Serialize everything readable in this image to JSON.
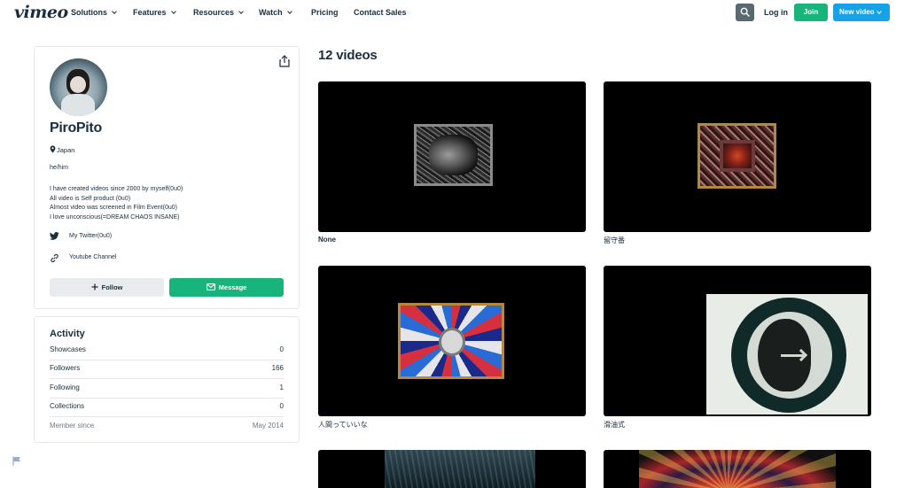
{
  "nav": {
    "logo": "vimeo",
    "items": [
      {
        "label": "Solutions",
        "dropdown": true
      },
      {
        "label": "Features",
        "dropdown": true
      },
      {
        "label": "Resources",
        "dropdown": true
      },
      {
        "label": "Watch",
        "dropdown": true
      },
      {
        "label": "Pricing",
        "dropdown": false
      },
      {
        "label": "Contact Sales",
        "dropdown": false
      }
    ],
    "login": "Log in",
    "join": "Join",
    "new_video": "New video"
  },
  "profile": {
    "name": "PiroPito",
    "location": "Japan",
    "pronouns": "he/him",
    "bio": [
      "I have created videos since 2000 by myself(0u0)",
      "All video is Self product (0u0)",
      "Almost video was screened in Film Event(0u0)",
      "I love unconscious(=DREAM CHAOS INSANE)"
    ],
    "links": [
      {
        "label": "My Twitter(0u0)",
        "icon": "twitter-icon"
      },
      {
        "label": "Youtube Channel",
        "icon": "link-icon"
      }
    ],
    "follow_label": "Follow",
    "message_label": "Message"
  },
  "activity": {
    "title": "Activity",
    "rows": [
      {
        "label": "Showcases",
        "value": "0"
      },
      {
        "label": "Followers",
        "value": "166"
      },
      {
        "label": "Following",
        "value": "1"
      },
      {
        "label": "Collections",
        "value": "0"
      },
      {
        "label": "Member since",
        "value": "May 2014"
      }
    ]
  },
  "videos": {
    "title": "12 videos",
    "items": [
      {
        "title": "None"
      },
      {
        "title": "留守番"
      },
      {
        "title": "人間っていいな"
      },
      {
        "title": "滑油式"
      },
      {
        "title": ""
      },
      {
        "title": ""
      }
    ]
  },
  "colors": {
    "text": "#1a2e3b",
    "join": "#17b57b",
    "new_video": "#17a2e8",
    "message": "#17b57b",
    "follow": "#e9ecee"
  }
}
